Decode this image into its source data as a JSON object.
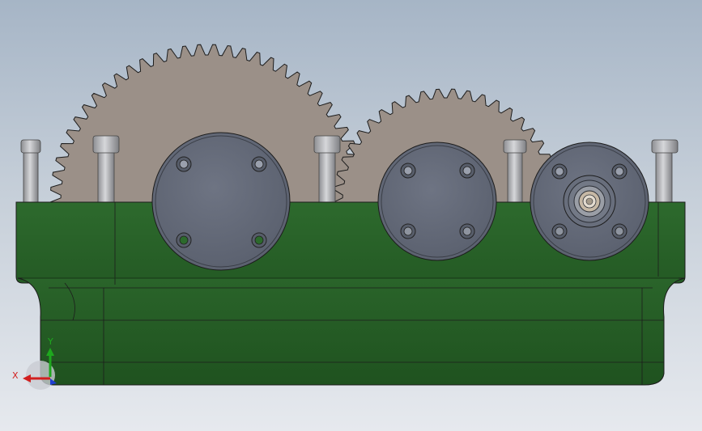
{
  "triad": {
    "x_label": "X",
    "y_label": "Y",
    "x_color": "#d21f1f",
    "y_color": "#1ea81e",
    "z_color": "#1f3fd2"
  },
  "colors": {
    "background_top": "#a6b5c6",
    "background_bottom": "#e6e9ee",
    "housing": "#2f6b2f",
    "housing_dark": "#225422",
    "gear": "#9b9088",
    "cover": "#646a78",
    "stud": "#a9aaad",
    "edge": "#1c1c1c"
  },
  "gears": [
    {
      "name": "large-gear",
      "teeth": 66
    },
    {
      "name": "small-gear",
      "teeth": 46
    }
  ],
  "bearing_covers": [
    {
      "name": "left-bearing-cover",
      "bolt_count": 4
    },
    {
      "name": "middle-bearing-cover",
      "bolt_count": 4
    },
    {
      "name": "right-bearing-cover",
      "bolt_count": 4,
      "shaft_visible": true
    }
  ]
}
